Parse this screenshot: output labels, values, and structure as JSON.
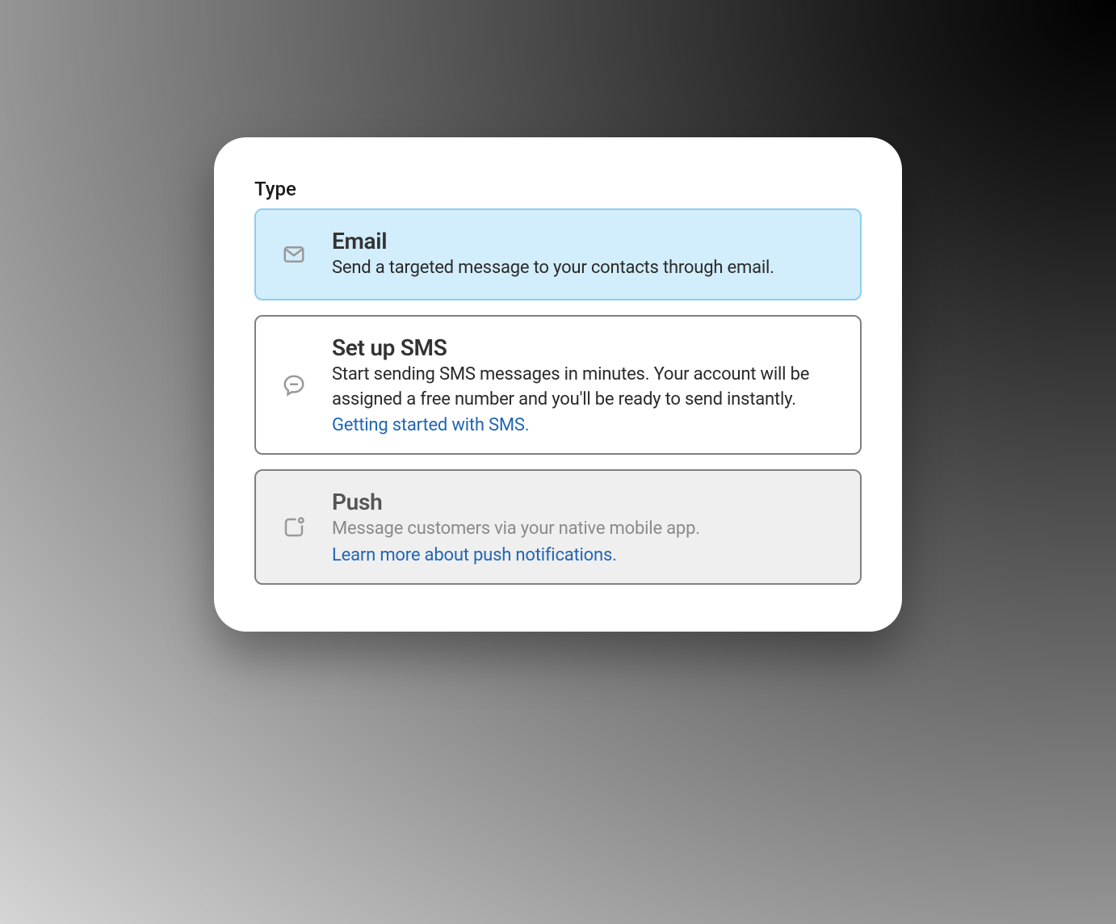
{
  "section": {
    "label": "Type"
  },
  "options": {
    "email": {
      "title": "Email",
      "description": "Send a targeted message to your contacts through email."
    },
    "sms": {
      "title": "Set up SMS",
      "description": "Start sending SMS messages in minutes. Your account will be assigned a free number and you'll be ready to send instantly.",
      "link": "Getting started with SMS."
    },
    "push": {
      "title": "Push",
      "description": "Message customers via your native mobile app.",
      "link": "Learn more about push notifications."
    }
  }
}
